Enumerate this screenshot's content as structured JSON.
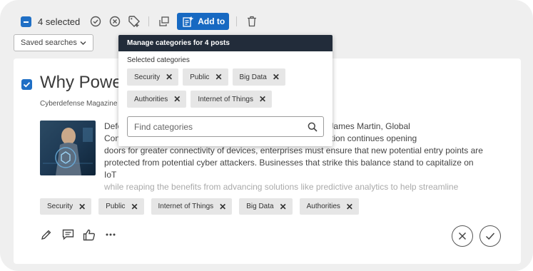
{
  "toolbar": {
    "selected_label": "4 selected",
    "add_to_label": "Add to",
    "icons": [
      "checkmark-circle-icon",
      "close-circle-icon",
      "tag-plus-icon",
      "duplicate-icon",
      "add-to-list-icon",
      "trash-icon"
    ]
  },
  "saved_searches": {
    "label": "Saved searches"
  },
  "card": {
    "title": "Why Power",
    "source": "Cyberdefense Magazine",
    "body_lines": [
      "Defe                                                              connectivity By James Martin, Global",
      "Con                                                               t as digital evolution continues opening",
      "doors for greater connectivity of devices, enterprises must ensure that new potential entry points are",
      "protected from potential cyber attackers. Businesses that strike this balance stand to capitalize on IoT",
      "while reaping the benefits from advancing solutions like predictive analytics to help streamline"
    ],
    "tags": [
      "Security",
      "Public",
      "Internet of Things",
      "Big Data",
      "Authorities"
    ],
    "action_icons": [
      "edit-icon",
      "comment-icon",
      "thumbs-up-icon",
      "more-icon"
    ],
    "reject_icon": "close-icon",
    "approve_icon": "check-icon"
  },
  "popover": {
    "title": "Manage categories for 4 posts",
    "subtitle": "Selected categories",
    "tags_row1": [
      "Security",
      "Public",
      "Big Data"
    ],
    "tags_row2": [
      "Authorities",
      "Internet of Things"
    ],
    "search_placeholder": "Find categories",
    "search_value": ""
  },
  "colors": {
    "accent": "#1769c2",
    "popover_header": "#222c3a",
    "tag_bg": "#e6e6e6"
  }
}
